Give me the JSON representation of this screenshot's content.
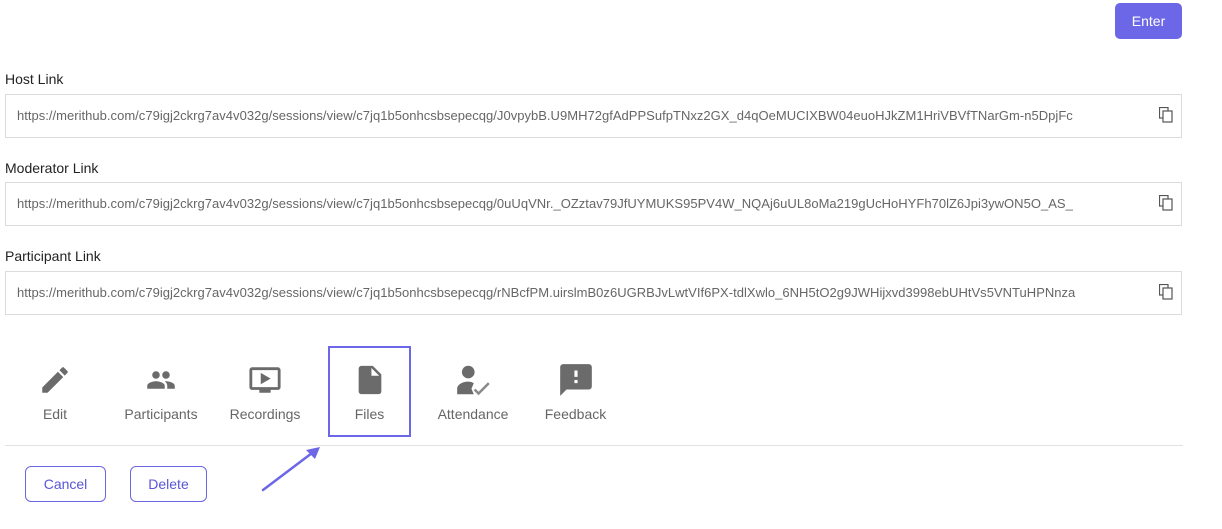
{
  "header": {
    "enter_label": "Enter"
  },
  "links": [
    {
      "label": "Host Link",
      "url": "https://merithub.com/c79igj2ckrg7av4v032g/sessions/view/c7jq1b5onhcsbsepecqg/J0vpybB.U9MH72gfAdPPSufpTNxz2GX_d4qOeMUCIXBW04euoHJkZM1HriVBVfTNarGm-n5DpjFc"
    },
    {
      "label": "Moderator Link",
      "url": "https://merithub.com/c79igj2ckrg7av4v032g/sessions/view/c7jq1b5onhcsbsepecqg/0uUqVNr._OZztav79JfUYMUKS95PV4W_NQAj6uUL8oMa219gUcHoHYFh70lZ6Jpi3ywON5O_AS_"
    },
    {
      "label": "Participant Link",
      "url": "https://merithub.com/c79igj2ckrg7av4v032g/sessions/view/c7jq1b5onhcsbsepecqg/rNBcfPM.uirslmB0z6UGRBJvLwtVIf6PX-tdlXwlo_6NH5tO2g9JWHijxvd3998ebUHtVs5VNTuHPNnza"
    }
  ],
  "actions": {
    "edit": "Edit",
    "participants": "Participants",
    "recordings": "Recordings",
    "files": "Files",
    "attendance": "Attendance",
    "feedback": "Feedback"
  },
  "footer": {
    "cancel_label": "Cancel",
    "delete_label": "Delete"
  },
  "icons": {
    "copy": "copy-icon",
    "edit": "pencil-icon",
    "participants": "people-icon",
    "recordings": "video-play-icon",
    "files": "file-icon",
    "attendance": "attendance-icon",
    "feedback": "feedback-icon"
  },
  "colors": {
    "accent": "#6c67e6",
    "icon": "#6b6b6b",
    "text_muted": "#666666"
  }
}
